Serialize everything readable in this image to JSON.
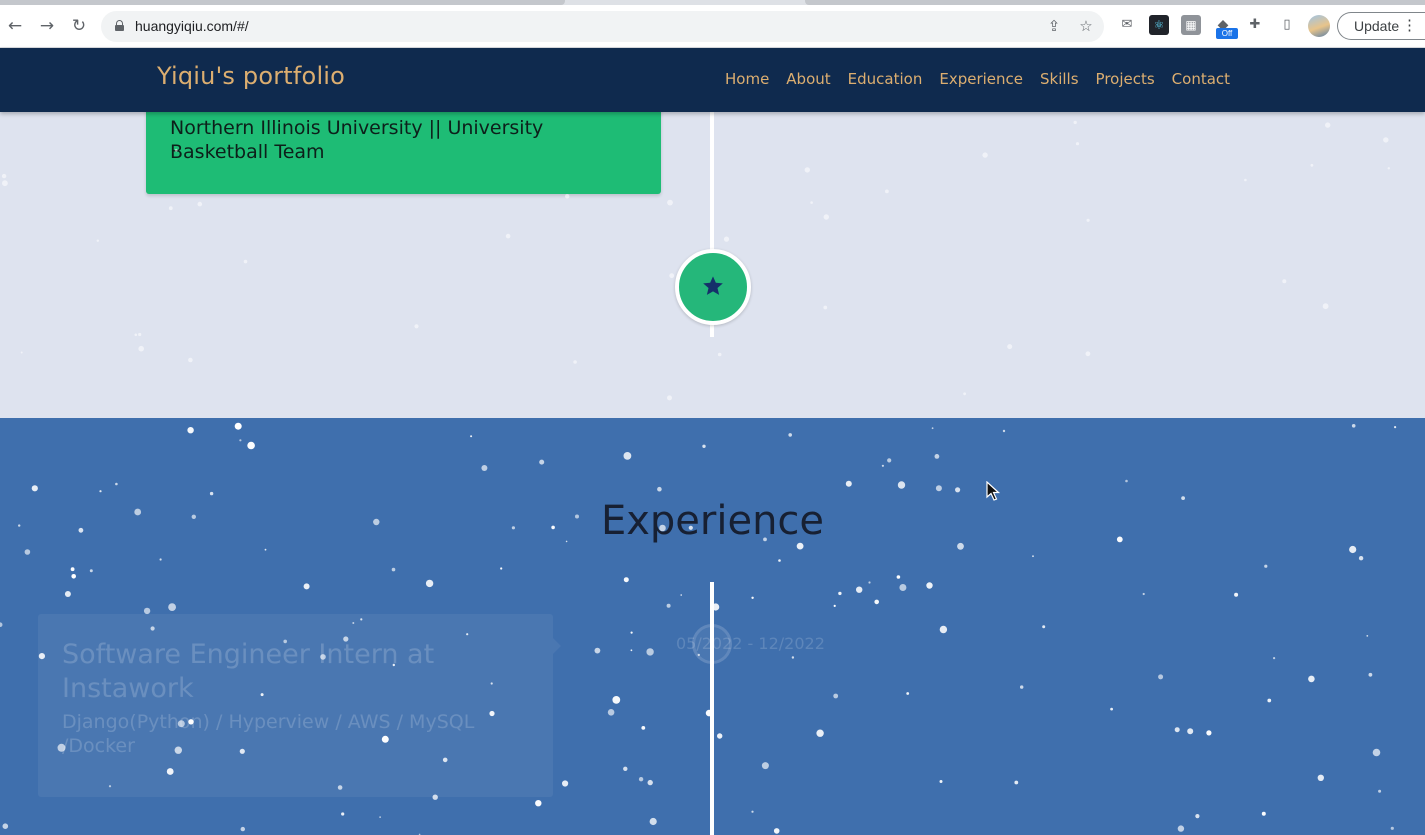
{
  "browser": {
    "url": "huangyiqiu.com/#/",
    "update_label": "Update",
    "extension_badge": "Off"
  },
  "site": {
    "brand": "Yiqiu's portfolio",
    "nav": [
      "Home",
      "About",
      "Education",
      "Experience",
      "Skills",
      "Projects",
      "Contact"
    ],
    "colors": {
      "header": "#0f2a4e",
      "brand": "#dcae70",
      "accent_green": "#1ebc75",
      "experience_bg": "#3f6fad"
    }
  },
  "education": {
    "card_text": "Northern Illinois University || University Basketball Team",
    "node_icon": "star-icon"
  },
  "experience": {
    "title": "Experience",
    "jobs": [
      {
        "title": "Software Engineer Intern at Instawork",
        "tech": "Django(Python) / Hyperview / AWS / MySQL /Docker",
        "date": "05/2022 - 12/2022"
      }
    ]
  }
}
